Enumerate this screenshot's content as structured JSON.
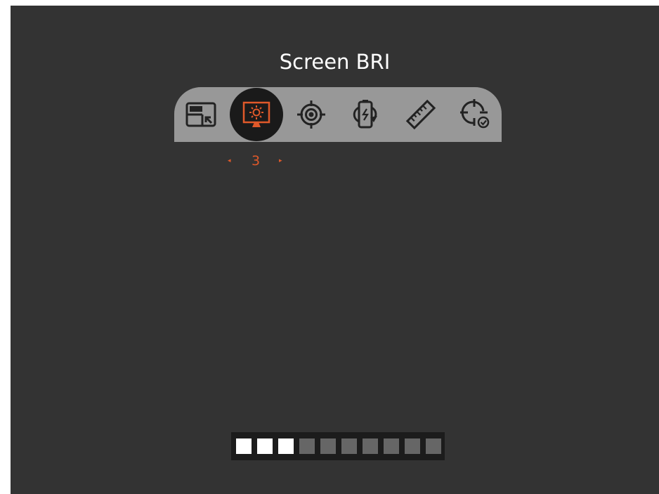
{
  "title": "Screen BRI",
  "menu": {
    "items": [
      {
        "icon": "picture-in-picture-icon",
        "selected": false
      },
      {
        "icon": "screen-brightness-icon",
        "selected": true
      },
      {
        "icon": "target-icon",
        "selected": false
      },
      {
        "icon": "battery-charging-rotate-icon",
        "selected": false
      },
      {
        "icon": "ruler-icon",
        "selected": false
      },
      {
        "icon": "crosshair-check-icon",
        "selected": false
      }
    ]
  },
  "selector": {
    "left_arrow": "◂",
    "value": "3",
    "right_arrow": "▸"
  },
  "level": {
    "value": 3,
    "max": 10
  },
  "colors": {
    "background": "#333333",
    "menu_bar": "#989898",
    "selected_circle": "#1a1a1a",
    "accent": "#e0592a",
    "icon_dark": "#222222",
    "level_on": "#ffffff",
    "level_off": "#666666"
  }
}
